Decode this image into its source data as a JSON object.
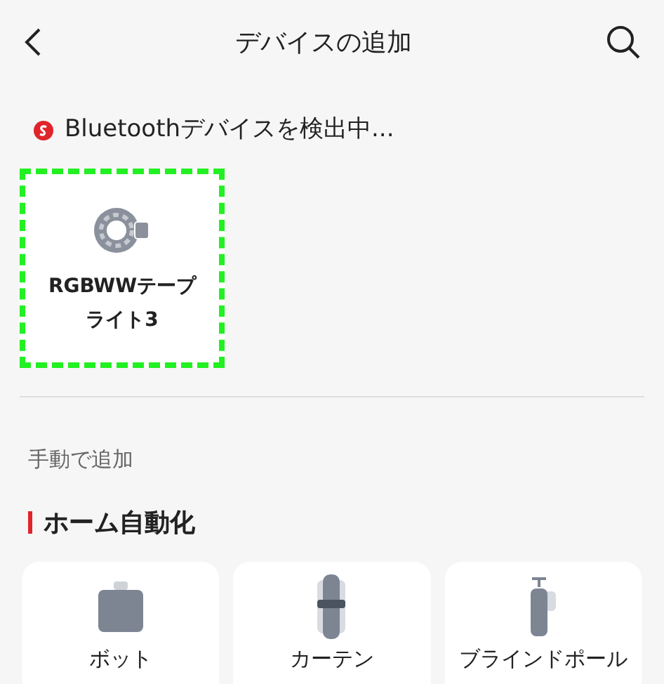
{
  "header": {
    "title": "デバイスの追加"
  },
  "scanning": {
    "text": "Bluetoothデバイスを検出中..."
  },
  "found_devices": [
    {
      "name": "RGBWWテープライト3",
      "highlighted": true
    }
  ],
  "manual": {
    "label": "手動で追加"
  },
  "category": {
    "title": "ホーム自動化"
  },
  "products": [
    {
      "kind": "bot",
      "name": "ボット"
    },
    {
      "kind": "curtain",
      "name": "カーテン"
    },
    {
      "kind": "pole",
      "name": "ブラインドポール"
    }
  ]
}
